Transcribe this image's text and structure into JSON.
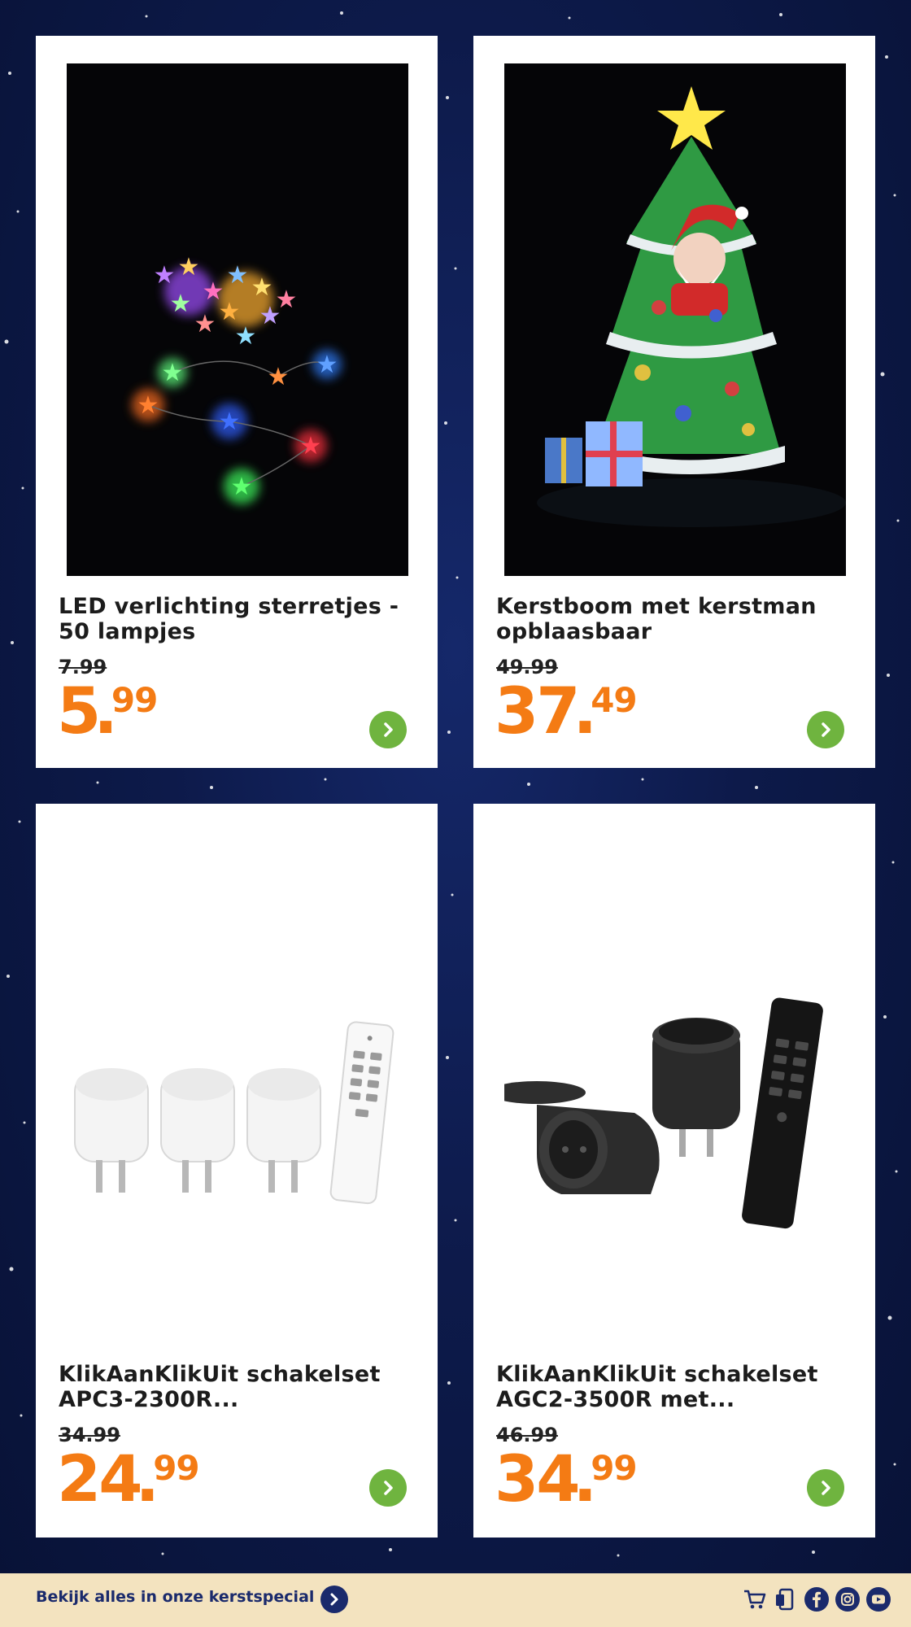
{
  "products": [
    {
      "title": "LED verlichting sterretjes - 50 lampjes",
      "old_price": "7.99",
      "price_main": "5",
      "price_cents": "99",
      "image": "star-lights-photo"
    },
    {
      "title": "Kerstboom met kerstman opblaasbaar",
      "old_price": "49.99",
      "price_main": "37",
      "price_cents": "49",
      "image": "inflatable-tree-photo"
    },
    {
      "title": "KlikAanKlikUit schakelset APC3-2300R...",
      "old_price": "34.99",
      "price_main": "24",
      "price_cents": "99",
      "image": "white-plugs-remote-photo"
    },
    {
      "title": "KlikAanKlikUit schakelset AGC2-3500R met...",
      "old_price": "46.99",
      "price_main": "34",
      "price_cents": "99",
      "image": "black-plugs-remote-photo"
    }
  ],
  "footer": {
    "link_text": "Bekijk alles in onze kerstspecial",
    "icons": [
      "cart-icon",
      "phone-icon",
      "facebook-icon",
      "instagram-icon",
      "youtube-icon"
    ]
  },
  "colors": {
    "price": "#f47b14",
    "go_button": "#6fb43f",
    "footer_bg": "#f3e3bf",
    "footer_text": "#1a2a6c",
    "background": "#0d1a4a"
  }
}
